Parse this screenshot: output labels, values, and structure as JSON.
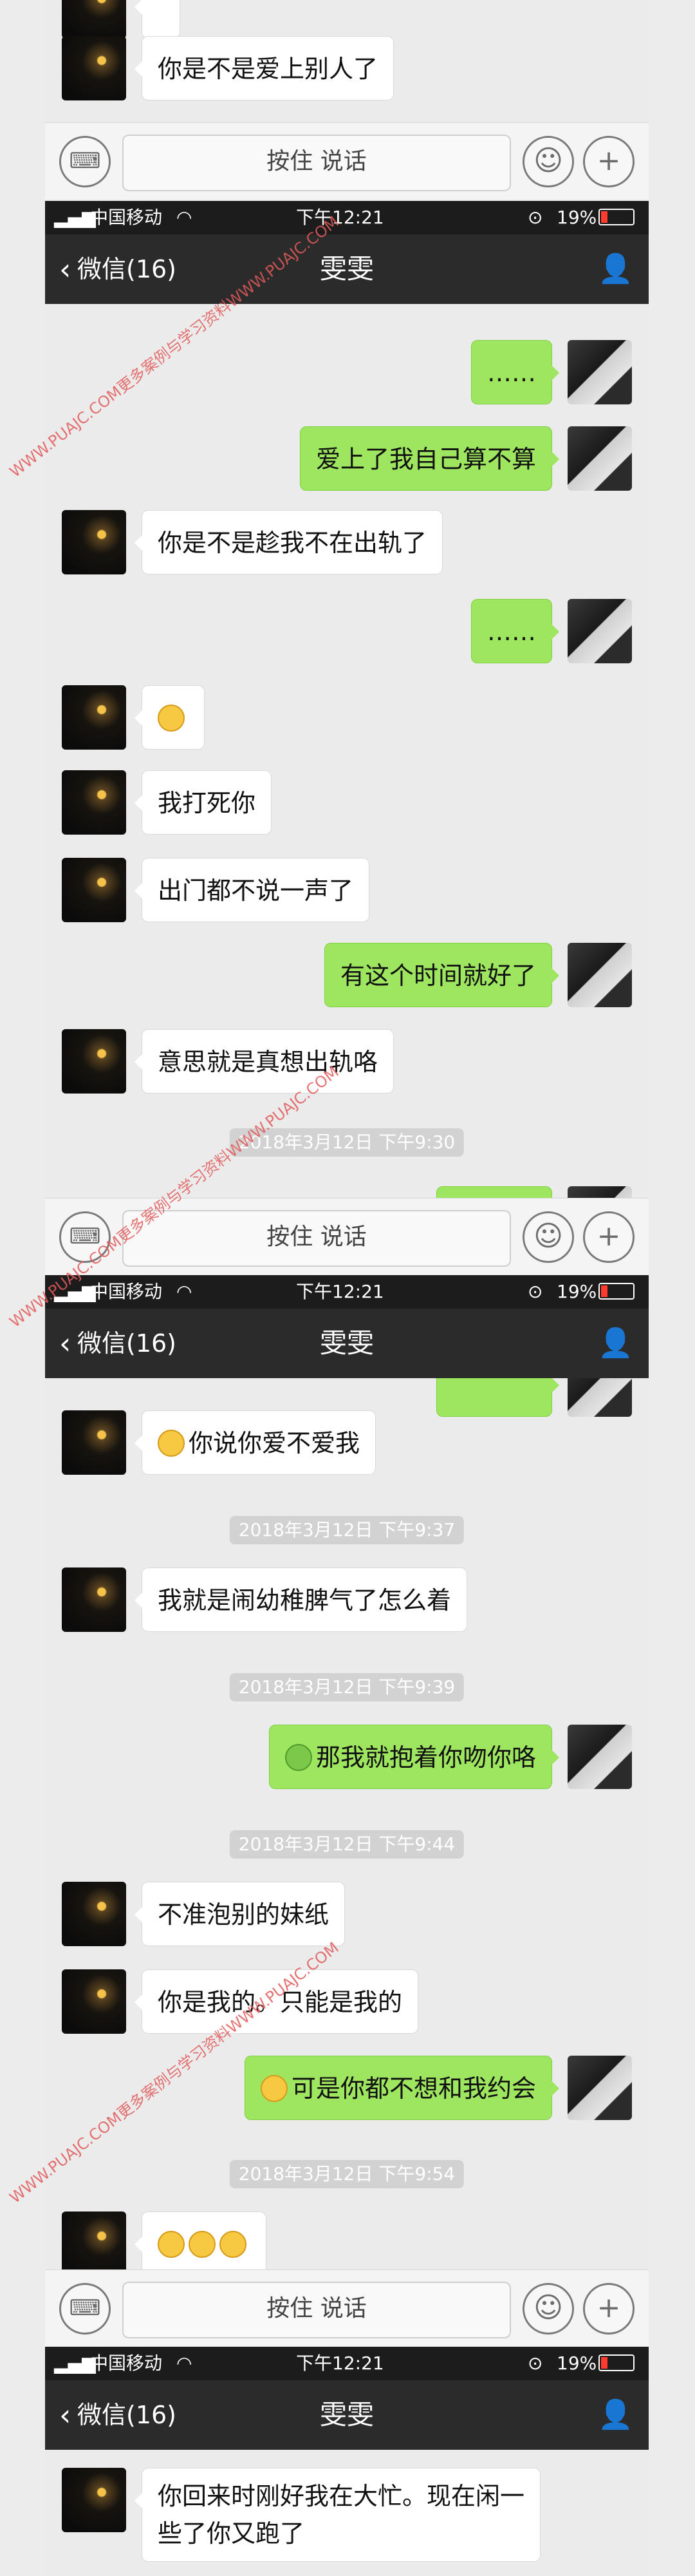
{
  "bottom_bar": {
    "talk_label": "按住 说话"
  },
  "status_bar": {
    "carrier": "中国移动",
    "time": "下午12:21",
    "battery": "19%"
  },
  "nav": {
    "back_label": "微信(16)",
    "title": "雯雯"
  },
  "watermark": "WWW.PUAJC.COM更多案例与学习资料WWW.PUAJC.COM",
  "section1": {
    "messages": [
      {
        "side": "left",
        "text": "你是不是爱上别人了"
      }
    ]
  },
  "section2": {
    "messages": [
      {
        "side": "right",
        "text": "……"
      },
      {
        "side": "right",
        "text": "爱上了我自己算不算"
      },
      {
        "side": "left",
        "text": "你是不是趁我不在出轨了"
      },
      {
        "side": "right",
        "text": "……"
      },
      {
        "side": "left",
        "text": "",
        "emoji": "confused-face"
      },
      {
        "side": "left",
        "text": "我打死你"
      },
      {
        "side": "left",
        "text": "出门都不说一声了"
      },
      {
        "side": "right",
        "text": "有这个时间就好了"
      },
      {
        "side": "left",
        "text": "意思就是真想出轨咯"
      }
    ],
    "timestamp": "2018年3月12日 下午9:30"
  },
  "section3": {
    "messages": [
      {
        "side": "left",
        "text": "你说你爱不爱我",
        "emoji": "confused-face"
      },
      {
        "side": "left",
        "text": "我就是闹幼稚脾气了怎么着"
      },
      {
        "side": "right",
        "text": "那我就抱着你吻你咯",
        "emoji": "hug-icon"
      },
      {
        "side": "left",
        "text": "不准泡别的妹纸"
      },
      {
        "side": "left",
        "text": "你是我的。只能是我的"
      },
      {
        "side": "right",
        "text": "可是你都不想和我约会",
        "emoji": "confused-face"
      },
      {
        "side": "left",
        "text": "",
        "emoji": "confused-face-x3"
      }
    ],
    "timestamps": [
      "2018年3月12日 下午9:37",
      "2018年3月12日 下午9:39",
      "2018年3月12日 下午9:44",
      "2018年3月12日 下午9:54"
    ]
  },
  "section4": {
    "messages": [
      {
        "side": "left",
        "text": "你回来时刚好我在大忙。现在闲一些了你又跑了"
      }
    ]
  }
}
